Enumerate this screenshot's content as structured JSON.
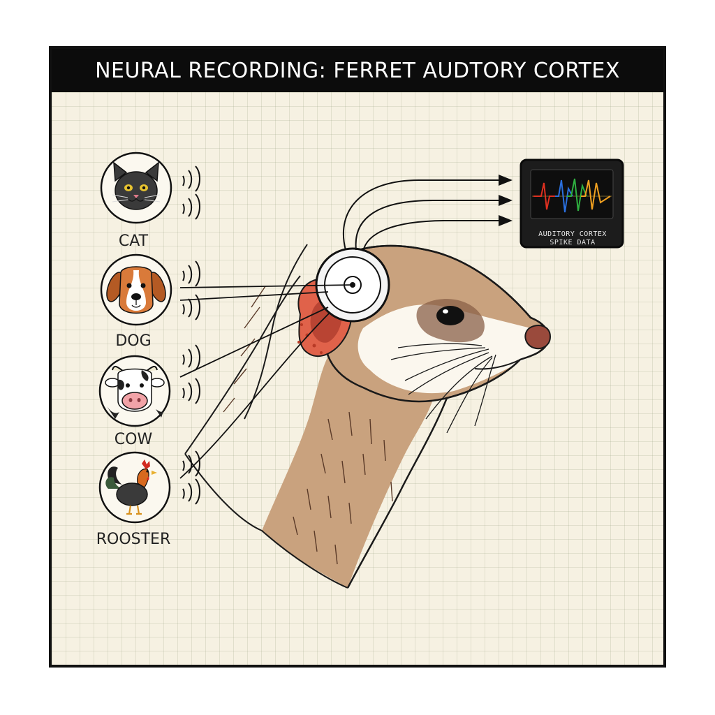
{
  "title": "NEURAL RECORDING: FERRET AUDTORY CORTEX",
  "stimuli": [
    {
      "label": "CAT",
      "icon": "cat-icon"
    },
    {
      "label": "DOG",
      "icon": "dog-icon"
    },
    {
      "label": "COW",
      "icon": "cow-icon"
    },
    {
      "label": "ROOSTER",
      "icon": "rooster-icon"
    }
  ],
  "monitor": {
    "label_line1": "AUDITORY CORTEX",
    "label_line2": "SPIKE DATA",
    "trace_colors": [
      "#e03020",
      "#2a70e0",
      "#2fb040",
      "#f0a020"
    ]
  },
  "colors": {
    "title_bar": "#0c0c0c",
    "grid_paper": "#f6f1e2",
    "ferret_fur": "#c9a27e",
    "inner_ear": "#e0624a"
  }
}
